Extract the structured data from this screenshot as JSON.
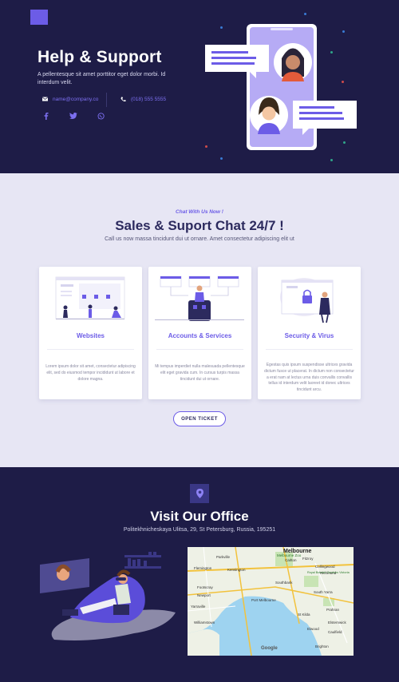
{
  "hero": {
    "title": "Help & Support",
    "text": "A pellentesque sit amet porttitor eget dolor morbi. Id interdum velit.",
    "email": "name@company.co",
    "phone": "(018) 555 5555"
  },
  "sales": {
    "kicker": "Chat With Us Now !",
    "title": "Sales & Suport Chat 24/7 !",
    "subtitle": "Call us now massa tincidunt dui ut ornare. Amet consectetur adipiscing elit ut",
    "cards": [
      {
        "title": "Websites",
        "body": "Lorem ipsum dolor sit amet, consectetur adipiscing elit, sed do eiusmod tempor incididunt ut labore et dolore magna."
      },
      {
        "title": "Accounts & Services",
        "body": "Mi tempus imperdiet nulla malesuada pellentesque elit eget gravida cum. In cursus turpis massa tincidunt dui ut ornare."
      },
      {
        "title": "Security & Virus",
        "body": "Egestas quis ipsum suspendisse ultrices gravida dictum fusce ut placerat. In dictum non consectetur a erat nam at lectus urna duis convallis convallis tellus id interdum velit laoreet id donec ultrices tincidunt arcu."
      }
    ],
    "button": "OPEN TICKET"
  },
  "office": {
    "title": "Visit Our Office",
    "address": "Politekhnicheskaya Ulitsa, 29, St Petersburg, Russia, 195251",
    "map": {
      "city": "Melbourne",
      "labels": [
        "Carlton",
        "Parkville",
        "Collingwood",
        "Flemington",
        "Kensington",
        "Footscray",
        "Yarraville",
        "Newport",
        "Port Melbourne",
        "Southbank",
        "South Yarra",
        "Richmond",
        "St Kilda",
        "Prahran",
        "Elwood",
        "Williamstown",
        "Caulfield",
        "Brighton",
        "Elsternwick",
        "Royal Botanic Gardens Victoria",
        "Melbourne Zoo",
        "Fitzroy"
      ],
      "attribution": "Google"
    }
  },
  "colors": {
    "navy": "#1e1c47",
    "accent": "#6c5ce7",
    "light": "#e7e6f4",
    "heading": "#2c2a5e"
  },
  "icons": [
    "logo-icon",
    "mail-icon",
    "phone-icon",
    "facebook-icon",
    "twitter-icon",
    "whatsapp-icon",
    "map-pin-icon"
  ]
}
